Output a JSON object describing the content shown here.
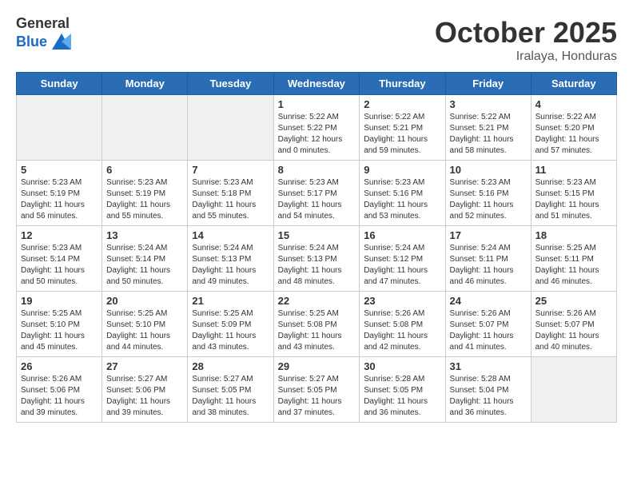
{
  "header": {
    "logo_general": "General",
    "logo_blue": "Blue",
    "month": "October 2025",
    "location": "Iralaya, Honduras"
  },
  "weekdays": [
    "Sunday",
    "Monday",
    "Tuesday",
    "Wednesday",
    "Thursday",
    "Friday",
    "Saturday"
  ],
  "rows": [
    [
      {
        "day": "",
        "info": "",
        "gray": true
      },
      {
        "day": "",
        "info": "",
        "gray": true
      },
      {
        "day": "",
        "info": "",
        "gray": true
      },
      {
        "day": "1",
        "info": "Sunrise: 5:22 AM\nSunset: 5:22 PM\nDaylight: 12 hours\nand 0 minutes.",
        "gray": false
      },
      {
        "day": "2",
        "info": "Sunrise: 5:22 AM\nSunset: 5:21 PM\nDaylight: 11 hours\nand 59 minutes.",
        "gray": false
      },
      {
        "day": "3",
        "info": "Sunrise: 5:22 AM\nSunset: 5:21 PM\nDaylight: 11 hours\nand 58 minutes.",
        "gray": false
      },
      {
        "day": "4",
        "info": "Sunrise: 5:22 AM\nSunset: 5:20 PM\nDaylight: 11 hours\nand 57 minutes.",
        "gray": false
      }
    ],
    [
      {
        "day": "5",
        "info": "Sunrise: 5:23 AM\nSunset: 5:19 PM\nDaylight: 11 hours\nand 56 minutes.",
        "gray": false
      },
      {
        "day": "6",
        "info": "Sunrise: 5:23 AM\nSunset: 5:19 PM\nDaylight: 11 hours\nand 55 minutes.",
        "gray": false
      },
      {
        "day": "7",
        "info": "Sunrise: 5:23 AM\nSunset: 5:18 PM\nDaylight: 11 hours\nand 55 minutes.",
        "gray": false
      },
      {
        "day": "8",
        "info": "Sunrise: 5:23 AM\nSunset: 5:17 PM\nDaylight: 11 hours\nand 54 minutes.",
        "gray": false
      },
      {
        "day": "9",
        "info": "Sunrise: 5:23 AM\nSunset: 5:16 PM\nDaylight: 11 hours\nand 53 minutes.",
        "gray": false
      },
      {
        "day": "10",
        "info": "Sunrise: 5:23 AM\nSunset: 5:16 PM\nDaylight: 11 hours\nand 52 minutes.",
        "gray": false
      },
      {
        "day": "11",
        "info": "Sunrise: 5:23 AM\nSunset: 5:15 PM\nDaylight: 11 hours\nand 51 minutes.",
        "gray": false
      }
    ],
    [
      {
        "day": "12",
        "info": "Sunrise: 5:23 AM\nSunset: 5:14 PM\nDaylight: 11 hours\nand 50 minutes.",
        "gray": false
      },
      {
        "day": "13",
        "info": "Sunrise: 5:24 AM\nSunset: 5:14 PM\nDaylight: 11 hours\nand 50 minutes.",
        "gray": false
      },
      {
        "day": "14",
        "info": "Sunrise: 5:24 AM\nSunset: 5:13 PM\nDaylight: 11 hours\nand 49 minutes.",
        "gray": false
      },
      {
        "day": "15",
        "info": "Sunrise: 5:24 AM\nSunset: 5:13 PM\nDaylight: 11 hours\nand 48 minutes.",
        "gray": false
      },
      {
        "day": "16",
        "info": "Sunrise: 5:24 AM\nSunset: 5:12 PM\nDaylight: 11 hours\nand 47 minutes.",
        "gray": false
      },
      {
        "day": "17",
        "info": "Sunrise: 5:24 AM\nSunset: 5:11 PM\nDaylight: 11 hours\nand 46 minutes.",
        "gray": false
      },
      {
        "day": "18",
        "info": "Sunrise: 5:25 AM\nSunset: 5:11 PM\nDaylight: 11 hours\nand 46 minutes.",
        "gray": false
      }
    ],
    [
      {
        "day": "19",
        "info": "Sunrise: 5:25 AM\nSunset: 5:10 PM\nDaylight: 11 hours\nand 45 minutes.",
        "gray": false
      },
      {
        "day": "20",
        "info": "Sunrise: 5:25 AM\nSunset: 5:10 PM\nDaylight: 11 hours\nand 44 minutes.",
        "gray": false
      },
      {
        "day": "21",
        "info": "Sunrise: 5:25 AM\nSunset: 5:09 PM\nDaylight: 11 hours\nand 43 minutes.",
        "gray": false
      },
      {
        "day": "22",
        "info": "Sunrise: 5:25 AM\nSunset: 5:08 PM\nDaylight: 11 hours\nand 43 minutes.",
        "gray": false
      },
      {
        "day": "23",
        "info": "Sunrise: 5:26 AM\nSunset: 5:08 PM\nDaylight: 11 hours\nand 42 minutes.",
        "gray": false
      },
      {
        "day": "24",
        "info": "Sunrise: 5:26 AM\nSunset: 5:07 PM\nDaylight: 11 hours\nand 41 minutes.",
        "gray": false
      },
      {
        "day": "25",
        "info": "Sunrise: 5:26 AM\nSunset: 5:07 PM\nDaylight: 11 hours\nand 40 minutes.",
        "gray": false
      }
    ],
    [
      {
        "day": "26",
        "info": "Sunrise: 5:26 AM\nSunset: 5:06 PM\nDaylight: 11 hours\nand 39 minutes.",
        "gray": false
      },
      {
        "day": "27",
        "info": "Sunrise: 5:27 AM\nSunset: 5:06 PM\nDaylight: 11 hours\nand 39 minutes.",
        "gray": false
      },
      {
        "day": "28",
        "info": "Sunrise: 5:27 AM\nSunset: 5:05 PM\nDaylight: 11 hours\nand 38 minutes.",
        "gray": false
      },
      {
        "day": "29",
        "info": "Sunrise: 5:27 AM\nSunset: 5:05 PM\nDaylight: 11 hours\nand 37 minutes.",
        "gray": false
      },
      {
        "day": "30",
        "info": "Sunrise: 5:28 AM\nSunset: 5:05 PM\nDaylight: 11 hours\nand 36 minutes.",
        "gray": false
      },
      {
        "day": "31",
        "info": "Sunrise: 5:28 AM\nSunset: 5:04 PM\nDaylight: 11 hours\nand 36 minutes.",
        "gray": false
      },
      {
        "day": "",
        "info": "",
        "gray": true
      }
    ]
  ]
}
